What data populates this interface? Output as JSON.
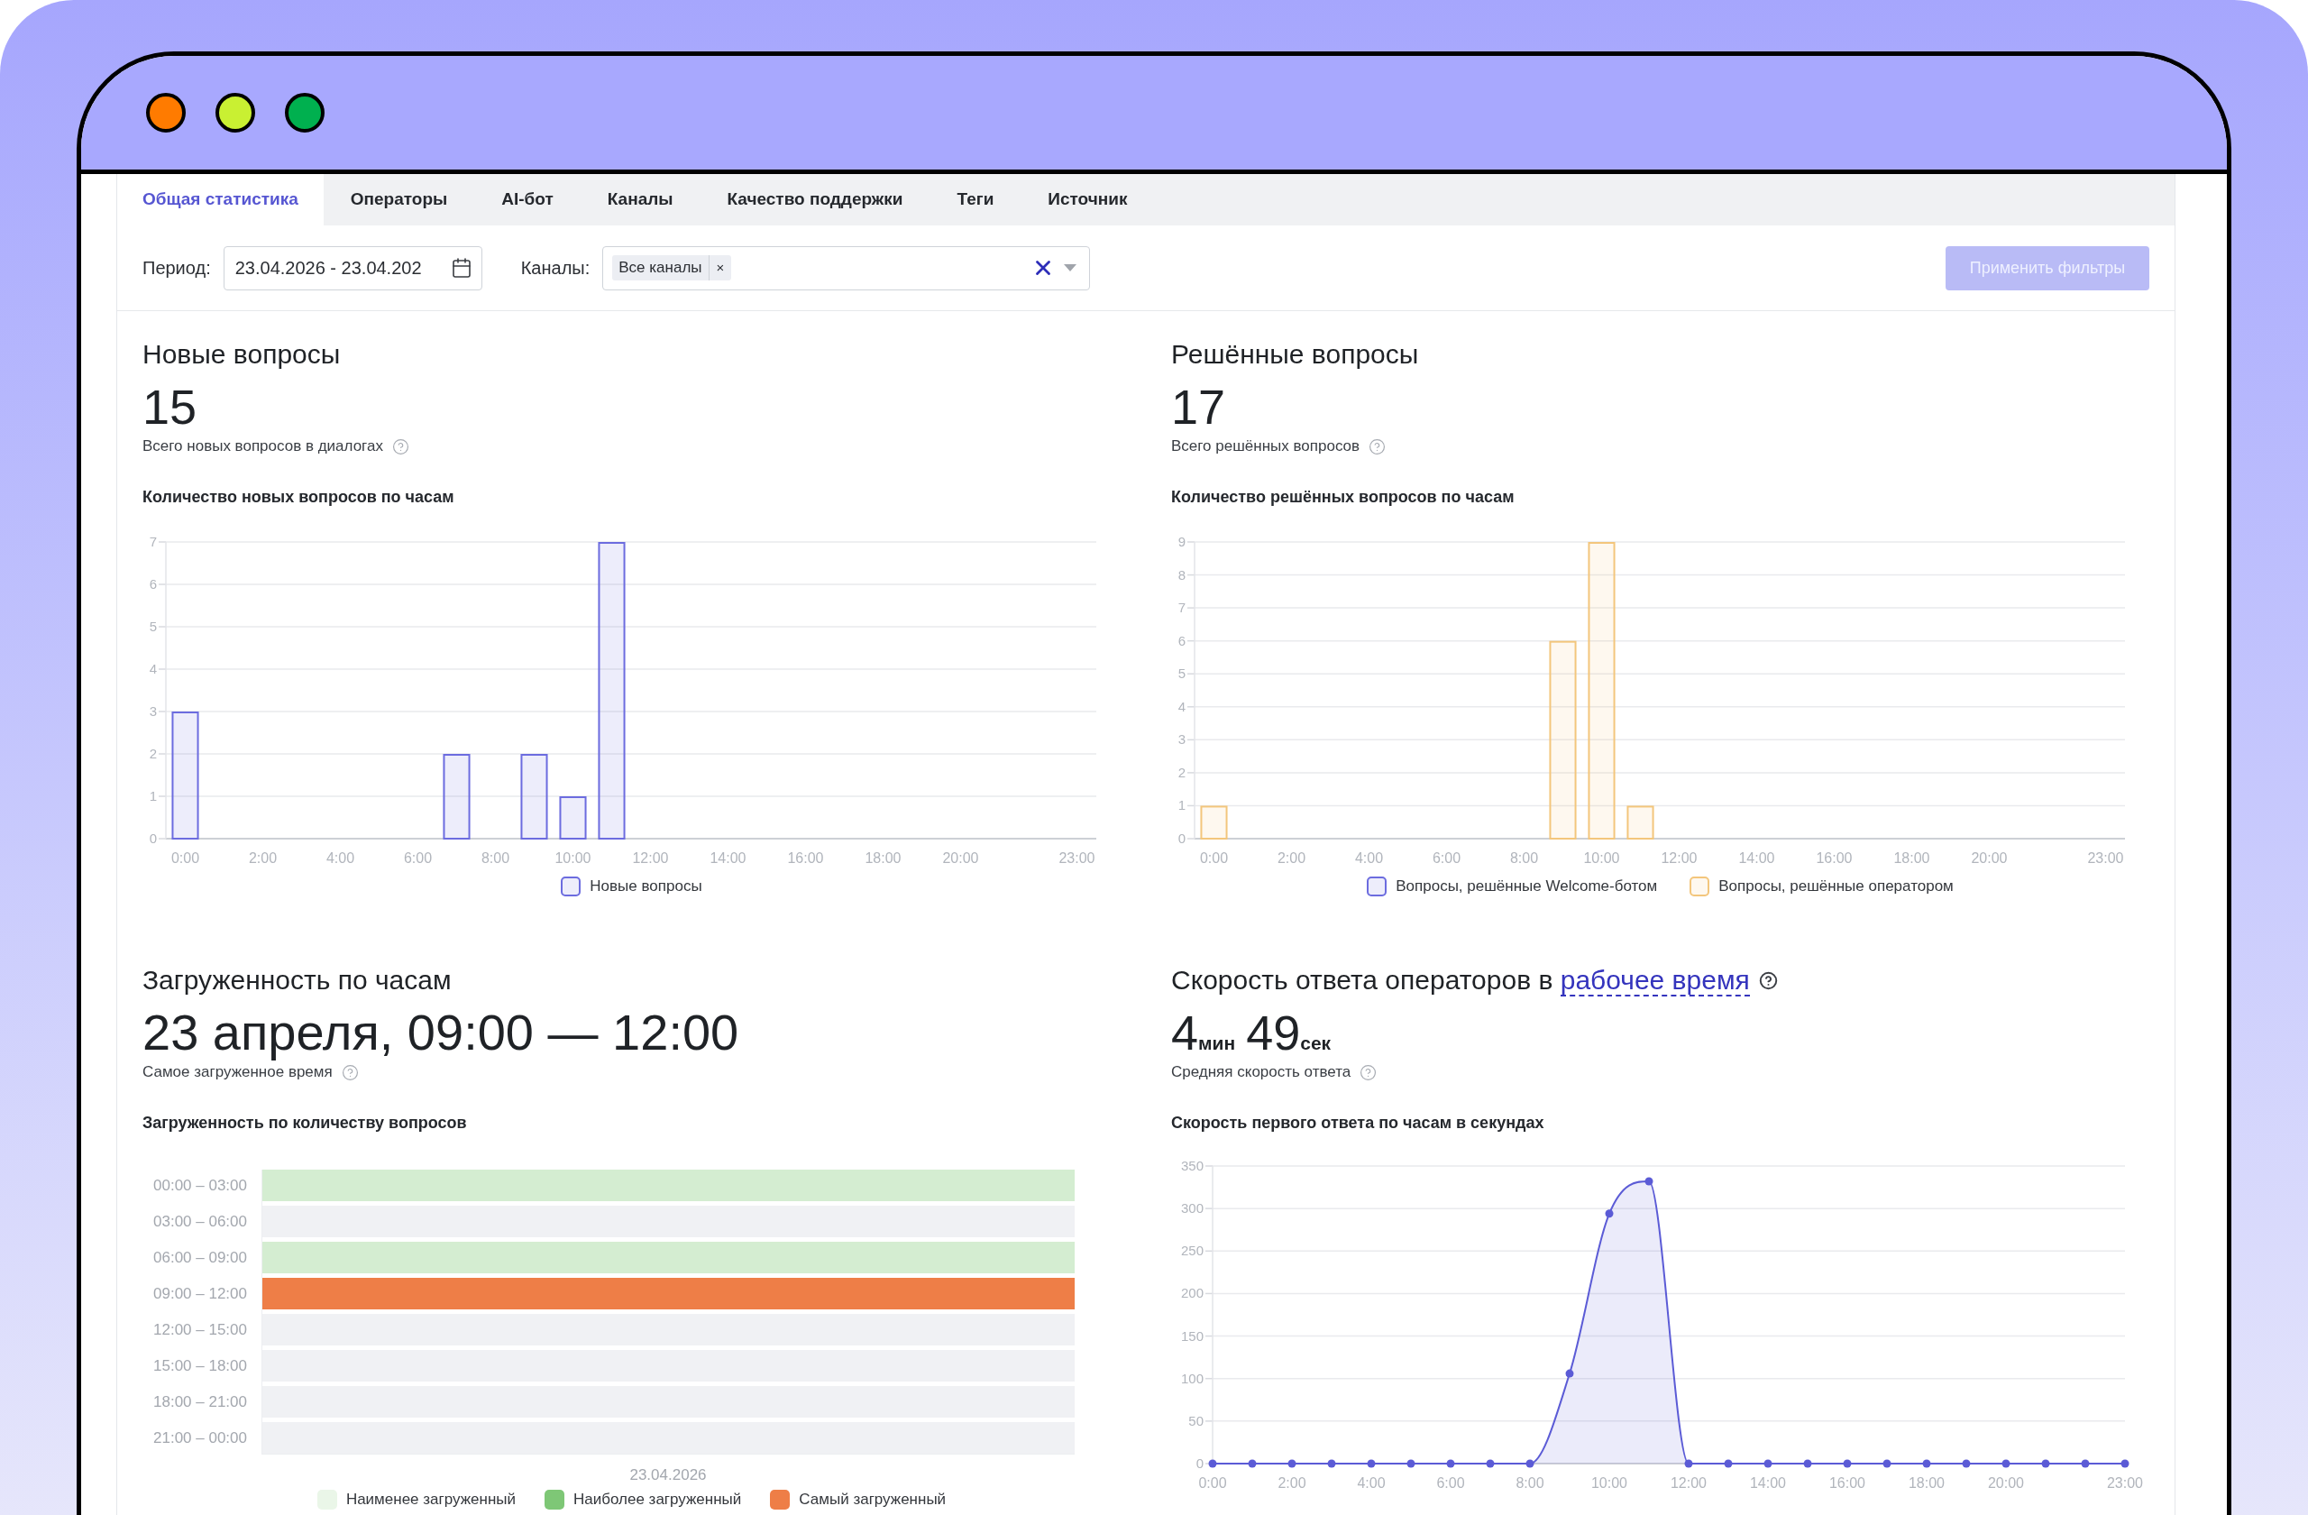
{
  "tabs": [
    {
      "label": "Общая статистика",
      "selected": true
    },
    {
      "label": "Операторы",
      "selected": false
    },
    {
      "label": "AI-бот",
      "selected": false
    },
    {
      "label": "Каналы",
      "selected": false
    },
    {
      "label": "Качество поддержки",
      "selected": false
    },
    {
      "label": "Теги",
      "selected": false
    },
    {
      "label": "Источник",
      "selected": false
    }
  ],
  "filters": {
    "period": {
      "label": "Период:",
      "value": "23.04.2026 - 23.04.202"
    },
    "channels": {
      "label": "Каналы:",
      "tags": [
        {
          "label": "Все каналы",
          "remove": "×"
        }
      ]
    },
    "apply_button": {
      "label": "Применить фильтры",
      "disabled": true
    }
  },
  "panels": [
    {
      "kind": "chart",
      "title": "Новые вопросы",
      "value": "15",
      "subtitle": "Всего новых вопросов в диалогах",
      "chart_title": "Количество новых вопросов по часам",
      "chart_data": {
        "type": "bar",
        "x": [
          0,
          1,
          2,
          3,
          4,
          5,
          6,
          7,
          8,
          9,
          10,
          11,
          12,
          13,
          14,
          15,
          16,
          17,
          18,
          19,
          20,
          21,
          22,
          23
        ],
        "series": [
          {
            "name": "Новые вопросы",
            "color": "#6c6cdf",
            "values": [
              3,
              0,
              0,
              0,
              0,
              0,
              0,
              2,
              0,
              2,
              1,
              7,
              0,
              0,
              0,
              0,
              0,
              0,
              0,
              0,
              0,
              0,
              0,
              0
            ]
          }
        ],
        "xlim": [
          -0.5,
          23.5
        ],
        "ylim": [
          0,
          7
        ],
        "grid": true,
        "yticks": [
          0,
          1,
          2,
          3,
          4,
          5,
          6,
          7
        ],
        "xticks": [
          {
            "value": 0,
            "label": "0:00"
          },
          {
            "value": 2,
            "label": "2:00"
          },
          {
            "value": 4,
            "label": "4:00"
          },
          {
            "value": 6,
            "label": "6:00"
          },
          {
            "value": 8,
            "label": "8:00"
          },
          {
            "value": 10,
            "label": "10:00"
          },
          {
            "value": 12,
            "label": "12:00"
          },
          {
            "value": 14,
            "label": "14:00"
          },
          {
            "value": 16,
            "label": "16:00"
          },
          {
            "value": 18,
            "label": "18:00"
          },
          {
            "value": 20,
            "label": "20:00"
          },
          {
            "value": 23,
            "label": "23:00"
          }
        ]
      }
    },
    {
      "kind": "chart",
      "title": "Решённые вопросы",
      "value": "17",
      "subtitle": "Всего решённых вопросов",
      "chart_title": "Количество решённых вопросов по часам",
      "chart_data": {
        "type": "bar",
        "stacked": true,
        "x": [
          0,
          1,
          2,
          3,
          4,
          5,
          6,
          7,
          8,
          9,
          10,
          11,
          12,
          13,
          14,
          15,
          16,
          17,
          18,
          19,
          20,
          21,
          22,
          23
        ],
        "series": [
          {
            "name": "Вопросы, решённые Welcome-ботом",
            "color": "#6c6cdf",
            "values": [
              0,
              0,
              0,
              0,
              0,
              0,
              0,
              0,
              0,
              0,
              0,
              0,
              0,
              0,
              0,
              0,
              0,
              0,
              0,
              0,
              0,
              0,
              0,
              0
            ]
          },
          {
            "name": "Вопросы, решённые оператором",
            "color": "#f3c67c",
            "values": [
              1,
              0,
              0,
              0,
              0,
              0,
              0,
              0,
              0,
              6,
              9,
              1,
              0,
              0,
              0,
              0,
              0,
              0,
              0,
              0,
              0,
              0,
              0,
              0
            ]
          }
        ],
        "xlim": [
          -0.5,
          23.5
        ],
        "ylim": [
          0,
          9
        ],
        "grid": true,
        "yticks": [
          0,
          1,
          2,
          3,
          4,
          5,
          6,
          7,
          8,
          9
        ],
        "xticks": [
          {
            "value": 0,
            "label": "0:00"
          },
          {
            "value": 2,
            "label": "2:00"
          },
          {
            "value": 4,
            "label": "4:00"
          },
          {
            "value": 6,
            "label": "6:00"
          },
          {
            "value": 8,
            "label": "8:00"
          },
          {
            "value": 10,
            "label": "10:00"
          },
          {
            "value": 12,
            "label": "12:00"
          },
          {
            "value": 14,
            "label": "14:00"
          },
          {
            "value": 16,
            "label": "16:00"
          },
          {
            "value": 18,
            "label": "18:00"
          },
          {
            "value": 20,
            "label": "20:00"
          },
          {
            "value": 23,
            "label": "23:00"
          }
        ]
      }
    },
    {
      "kind": "heatmap",
      "title": "Загруженность по часам",
      "value": "23 апреля, 09:00 — 12:00",
      "subtitle": "Самое загруженное время",
      "chart_title": "Загруженность по количеству вопросов",
      "heatmap": {
        "rows": [
          {
            "label": "00:00 – 03:00",
            "color": "#d4edd1"
          },
          {
            "label": "03:00 – 06:00",
            "color": "#f0f1f4"
          },
          {
            "label": "06:00 – 09:00",
            "color": "#d4edd1"
          },
          {
            "label": "09:00 – 12:00",
            "color": "#ee7e47"
          },
          {
            "label": "12:00 – 15:00",
            "color": "#f0f1f4"
          },
          {
            "label": "15:00 – 18:00",
            "color": "#f0f1f4"
          },
          {
            "label": "18:00 – 21:00",
            "color": "#f0f1f4"
          },
          {
            "label": "21:00 – 00:00",
            "color": "#f0f1f4"
          }
        ],
        "column_label": "23.04.2026",
        "legend": [
          {
            "label": "Наименее загруженный",
            "color": "#eaf6e8"
          },
          {
            "label": "Наиболее загруженный",
            "color": "#7ec776"
          },
          {
            "label": "Самый загруженный",
            "color": "#ee7e47"
          }
        ]
      }
    },
    {
      "kind": "chart",
      "title": "Скорость ответа операторов в",
      "title_link": "рабочее время",
      "value_parts": [
        {
          "value": "4",
          "unit": "мин"
        },
        {
          "value": "49",
          "unit": "сек"
        }
      ],
      "subtitle": "Средняя скорость ответа",
      "chart_title": "Скорость первого ответа по часам в секундах",
      "chart_data": {
        "type": "area",
        "x": [
          0,
          1,
          2,
          3,
          4,
          5,
          6,
          7,
          8,
          9,
          10,
          11,
          12,
          13,
          14,
          15,
          16,
          17,
          18,
          19,
          20,
          21,
          22,
          23
        ],
        "series": [
          {
            "color": "#5b5bd6",
            "values": [
              0,
              0,
              0,
              0,
              0,
              0,
              0,
              0,
              0,
              106,
              294,
              332,
              0,
              0,
              0,
              0,
              0,
              0,
              0,
              0,
              0,
              0,
              0,
              0
            ]
          }
        ],
        "xlim": [
          0,
          23
        ],
        "ylim": [
          0,
          350
        ],
        "grid": true,
        "yticks": [
          0,
          50,
          100,
          150,
          200,
          250,
          300,
          350
        ],
        "xticks": [
          {
            "value": 0,
            "label": "0:00"
          },
          {
            "value": 2,
            "label": "2:00"
          },
          {
            "value": 4,
            "label": "4:00"
          },
          {
            "value": 6,
            "label": "6:00"
          },
          {
            "value": 8,
            "label": "8:00"
          },
          {
            "value": 10,
            "label": "10:00"
          },
          {
            "value": 12,
            "label": "12:00"
          },
          {
            "value": 14,
            "label": "14:00"
          },
          {
            "value": 16,
            "label": "16:00"
          },
          {
            "value": 18,
            "label": "18:00"
          },
          {
            "value": 20,
            "label": "20:00"
          },
          {
            "value": 23,
            "label": "23:00"
          }
        ]
      }
    }
  ]
}
